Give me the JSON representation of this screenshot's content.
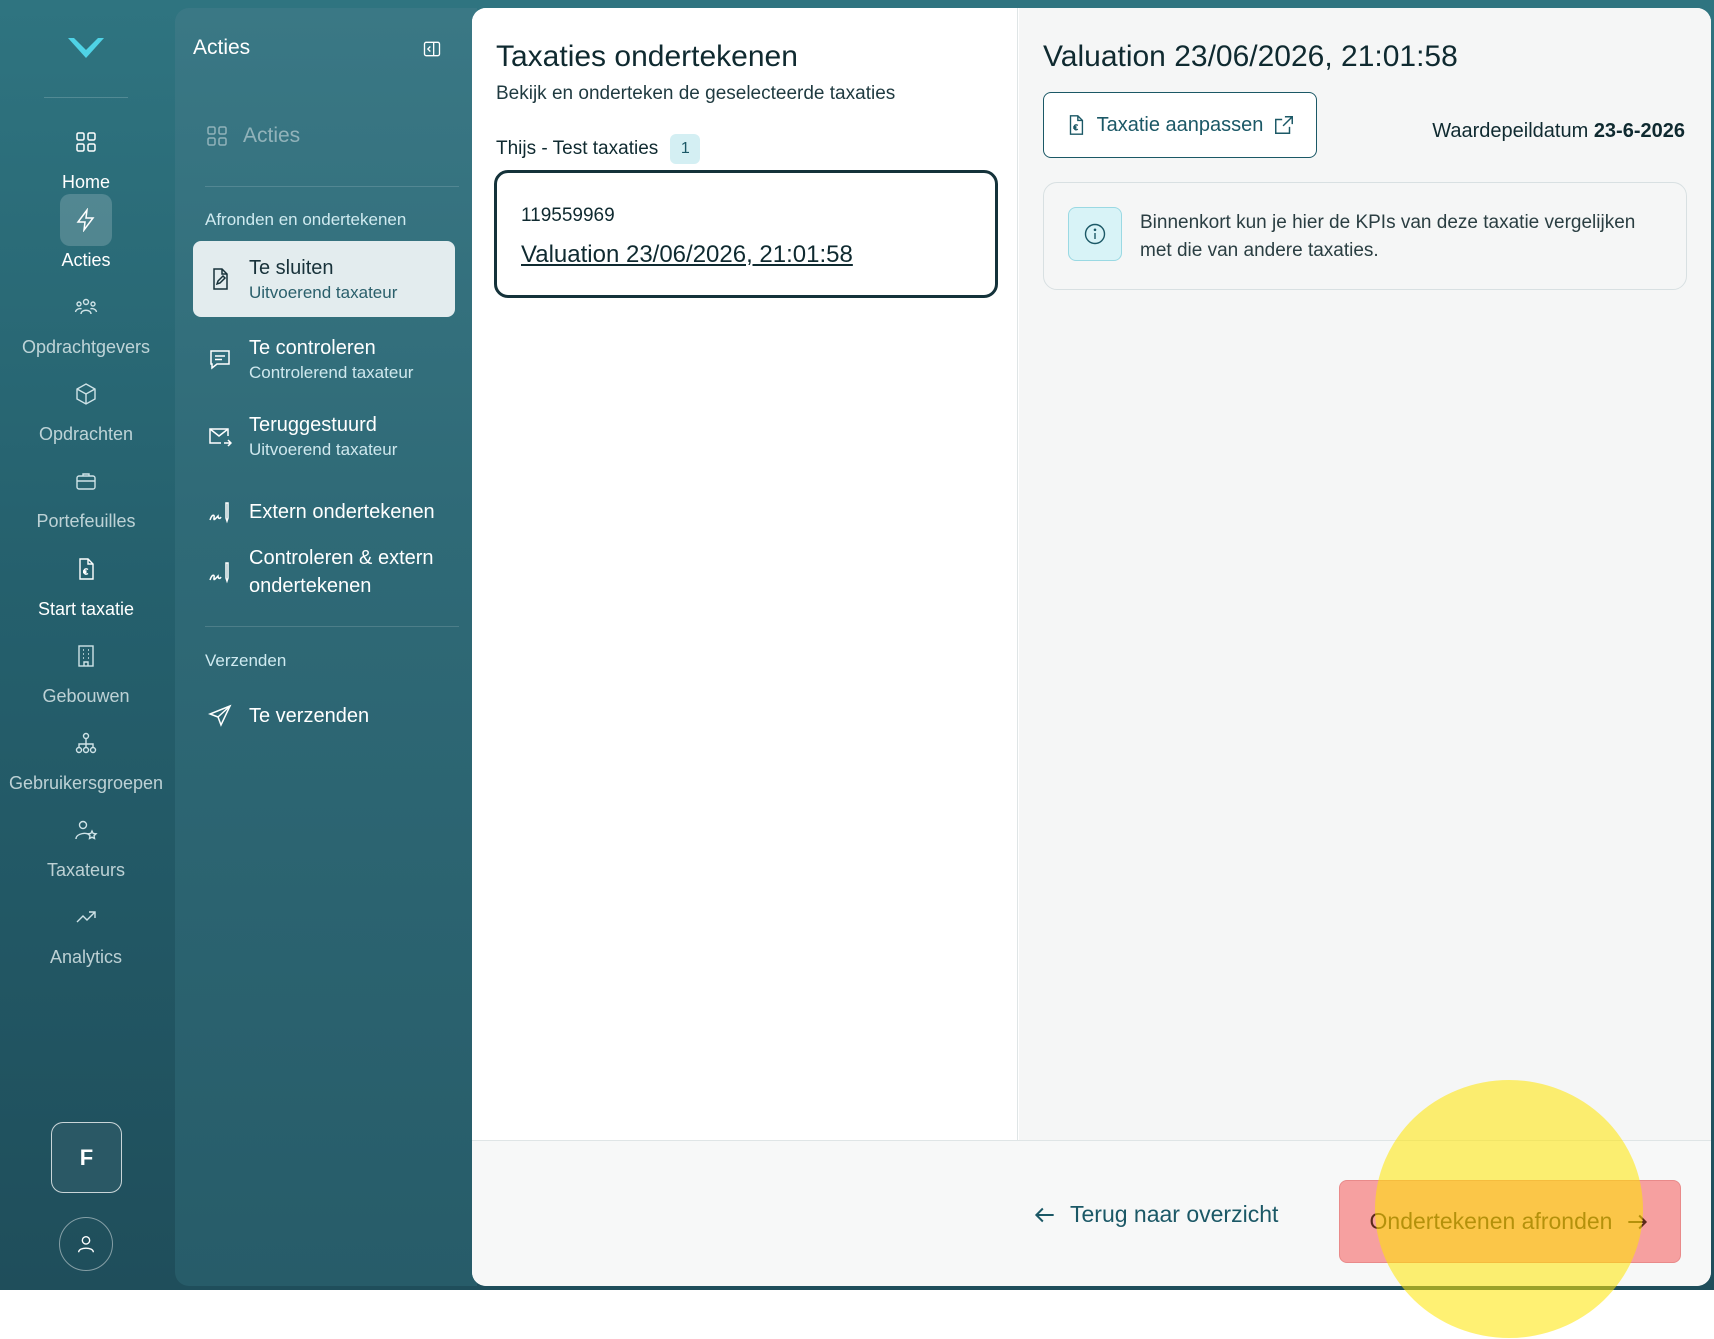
{
  "rail": {
    "items": [
      {
        "label": "Home",
        "icon": "home-icon"
      },
      {
        "label": "Acties",
        "icon": "lightning-icon"
      },
      {
        "label": "Opdrachtgevers",
        "icon": "users-icon"
      },
      {
        "label": "Opdrachten",
        "icon": "cube-icon"
      },
      {
        "label": "Portefeuilles",
        "icon": "briefcase-icon"
      },
      {
        "label": "Start taxatie",
        "icon": "document-euro-icon"
      },
      {
        "label": "Gebouwen",
        "icon": "building-icon"
      },
      {
        "label": "Gebruikersgroepen",
        "icon": "hierarchy-icon"
      },
      {
        "label": "Taxateurs",
        "icon": "user-star-icon"
      },
      {
        "label": "Analytics",
        "icon": "trend-icon"
      }
    ],
    "avatar_letter": "F"
  },
  "sidebar": {
    "title": "Acties",
    "acties_label": "Acties",
    "section_afronden": "Afronden en ondertekenen",
    "items": [
      {
        "label": "Te sluiten",
        "sub": "Uitvoerend taxateur"
      },
      {
        "label": "Te controleren",
        "sub": "Controlerend taxateur"
      },
      {
        "label": "Teruggestuurd",
        "sub": "Uitvoerend taxateur"
      },
      {
        "label": "Extern ondertekenen"
      },
      {
        "label": "Controleren & extern ondertekenen"
      }
    ],
    "section_verzenden": "Verzenden",
    "verzenden_item": "Te verzenden"
  },
  "left": {
    "title": "Taxaties ondertekenen",
    "subtitle": "Bekijk en onderteken de geselecteerde taxaties",
    "group_name": "Thijs - Test taxaties",
    "group_count": "1",
    "card": {
      "id": "119559969",
      "link": "Valuation 23/06/2026, 21:01:58"
    }
  },
  "right": {
    "title": "Valuation 23/06/2026, 21:01:58",
    "edit_button": "Taxatie aanpassen",
    "peildatum_label": "Waardepeildatum",
    "peildatum_value": "23-6-2026",
    "info_text": "Binnenkort kun je hier de KPIs van deze taxatie vergelijken met die van andere taxaties."
  },
  "footer": {
    "back_label": "Terug naar overzicht",
    "finish_label": "Ondertekenen afronden"
  },
  "colors": {
    "accent": "#1b5866",
    "finish_button": "#f6a0a0",
    "highlight": "#ffe600"
  }
}
